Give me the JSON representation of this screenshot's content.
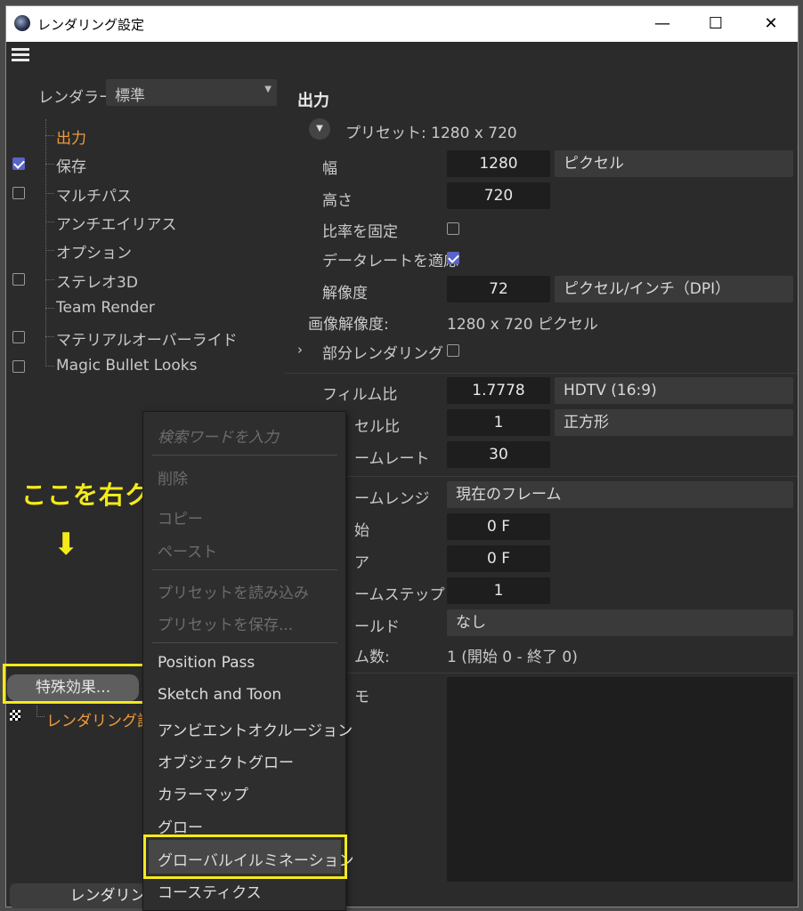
{
  "window": {
    "title": "レンダリング設定",
    "minimize": "—",
    "maximize": "☐",
    "close": "✕"
  },
  "left": {
    "renderer_label": "レンダラー",
    "renderer_value": "標準",
    "tree": [
      "出力",
      "保存",
      "マルチパス",
      "アンチエイリアス",
      "オプション",
      "ステレオ3D",
      "Team Render",
      "マテリアルオーバーライド",
      "Magic Bullet Looks"
    ],
    "effects_button": "特殊効果...",
    "render_setting_item": "レンダリング設定",
    "render_button": "レンダリン"
  },
  "right": {
    "section_title": "出力",
    "preset": "プリセット: 1280 x 720",
    "width_label": "幅",
    "width_value": "1280",
    "width_unit": "ピクセル",
    "height_label": "高さ",
    "height_value": "720",
    "lock_ratio_label": "比率を固定",
    "adapt_rate_label": "データレートを適応",
    "resolution_label": "解像度",
    "resolution_value": "72",
    "resolution_unit": "ピクセル/インチ（DPI）",
    "image_res_label": "画像解像度:",
    "image_res_value": "1280 x 720 ピクセル",
    "region_label": "部分レンダリング",
    "film_aspect_label": "フィルム比",
    "film_aspect_value": "1.7778",
    "film_aspect_preset": "HDTV (16:9)",
    "pixel_aspect_label": "セル比",
    "pixel_aspect_value": "1",
    "pixel_aspect_preset": "正方形",
    "frame_rate_label": "ームレート",
    "frame_rate_value": "30",
    "frame_range_label": "ームレンジ",
    "frame_range_value": "現在のフレーム",
    "from_label": "始",
    "from_value": "0 F",
    "to_label": "ア",
    "to_value": "0 F",
    "frame_step_label": "ームステップ",
    "frame_step_value": "1",
    "field_label": "ールド",
    "field_value": "なし",
    "frames_label": "ム数:",
    "frames_value": "1 (開始 0 - 終了 0)",
    "notes_label": "モ"
  },
  "context_menu": {
    "search_placeholder": "検索ワードを入力",
    "delete": "削除",
    "copy": "コピー",
    "paste": "ペースト",
    "load_preset": "プリセットを読み込み",
    "save_preset": "プリセットを保存...",
    "items": [
      "Position Pass",
      "Sketch and Toon",
      "アンビエントオクルージョン",
      "オブジェクトグロー",
      "カラーマップ",
      "グロー",
      "グローバルイルミネーション",
      "コースティクス"
    ]
  },
  "annotation": {
    "text": "ここを右クリックでも可",
    "arrow": "⬇"
  },
  "colors": {
    "accent_orange": "#ee9a3c",
    "highlight_yellow": "#f4ea1a",
    "checkbox_blue": "#5a63c6"
  }
}
